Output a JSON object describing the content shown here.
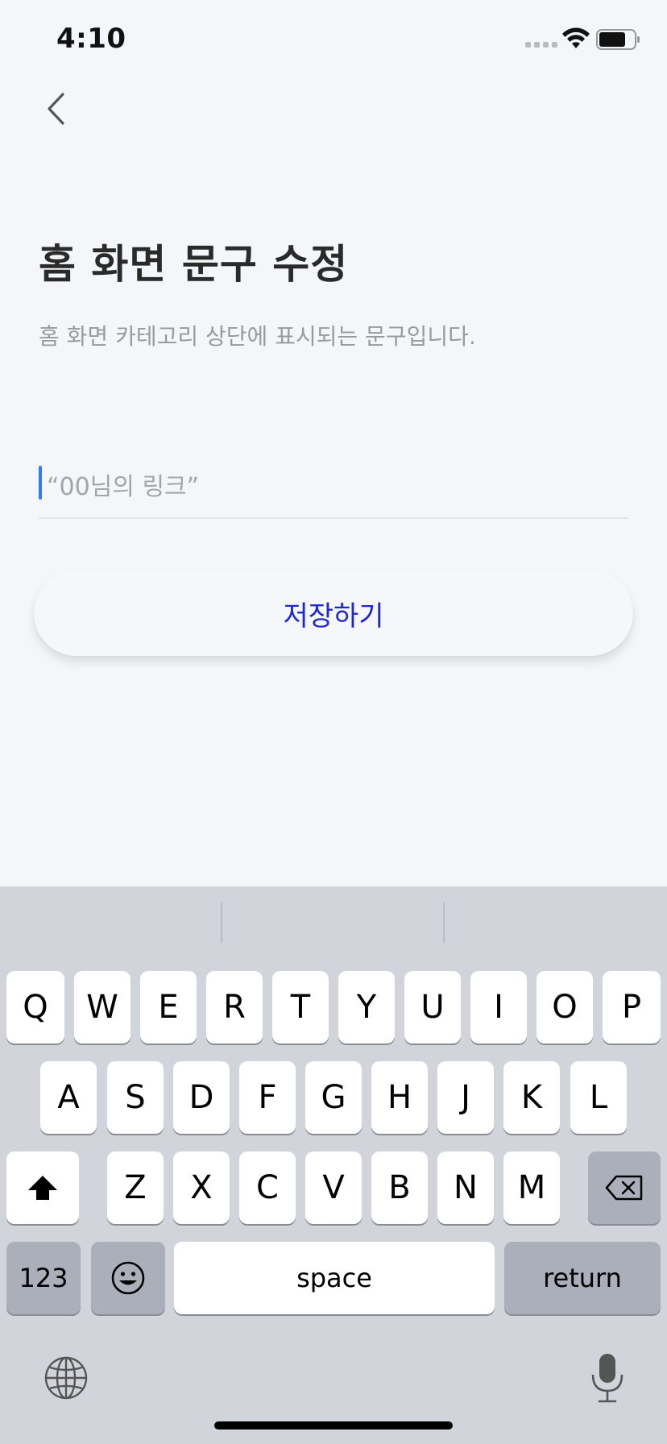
{
  "status_bar": {
    "time": "4:10"
  },
  "header": {
    "back_icon": "chevron-left-icon"
  },
  "page": {
    "title": "홈 화면 문구 수정",
    "subtitle": "홈 화면 카테고리 상단에 표시되는 문구입니다.",
    "input_placeholder": "“00님의 링크”",
    "input_value": "",
    "save_label": "저장하기"
  },
  "keyboard": {
    "row1": [
      "Q",
      "W",
      "E",
      "R",
      "T",
      "Y",
      "U",
      "I",
      "O",
      "P"
    ],
    "row2": [
      "A",
      "S",
      "D",
      "F",
      "G",
      "H",
      "J",
      "K",
      "L"
    ],
    "row3": [
      "Z",
      "X",
      "C",
      "V",
      "B",
      "N",
      "M"
    ],
    "numbers_label": "123",
    "space_label": "space",
    "return_label": "return"
  },
  "colors": {
    "accent": "#1c27d8",
    "caret": "#2f7cf6",
    "background": "#f5f6fa",
    "keyboard_bg": "#d1d4db"
  }
}
